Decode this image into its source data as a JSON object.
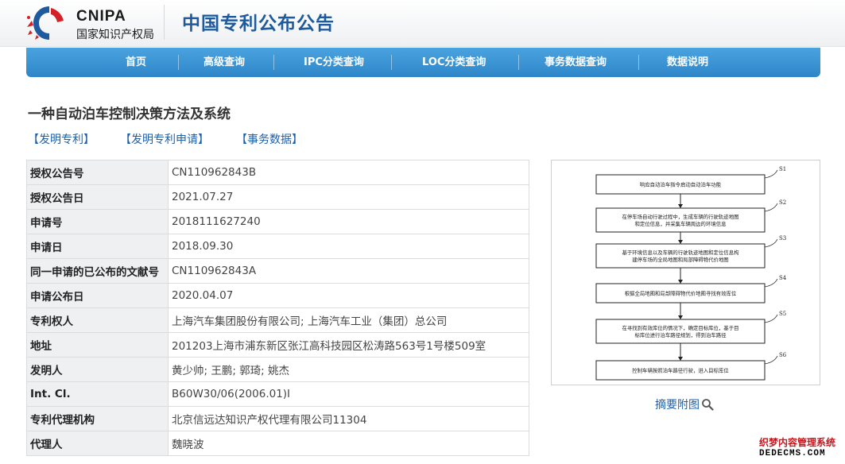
{
  "header": {
    "logo_en": "CNIPA",
    "logo_cn": "国家知识产权局",
    "site_title": "中国专利公布公告"
  },
  "nav": {
    "items": [
      "首页",
      "高级查询",
      "IPC分类查询",
      "LOC分类查询",
      "事务数据查询",
      "数据说明"
    ]
  },
  "document": {
    "title": "一种自动泊车控制决策方法及系统",
    "links": [
      "【发明专利】",
      "【发明专利申请】",
      "【事务数据】"
    ]
  },
  "info_rows": [
    {
      "label": "授权公告号",
      "value": "CN110962843B"
    },
    {
      "label": "授权公告日",
      "value": "2021.07.27"
    },
    {
      "label": "申请号",
      "value": "2018111627240"
    },
    {
      "label": "申请日",
      "value": "2018.09.30"
    },
    {
      "label": "同一申请的已公布的文献号",
      "value": "CN110962843A"
    },
    {
      "label": "申请公布日",
      "value": "2020.04.07"
    },
    {
      "label": "专利权人",
      "value": "上海汽车集团股份有限公司; 上海汽车工业（集团）总公司"
    },
    {
      "label": "地址",
      "value": "201203上海市浦东新区张江高科技园区松涛路563号1号楼509室"
    },
    {
      "label": "发明人",
      "value": "黄少帅; 王鹏; 郭琦; 姚杰"
    },
    {
      "label": "Int. Cl.",
      "value": "B60W30/06(2006.01)I"
    },
    {
      "label": "专利代理机构",
      "value": "北京信远达知识产权代理有限公司11304"
    },
    {
      "label": "代理人",
      "value": "魏晓波"
    }
  ],
  "drawing": {
    "steps": [
      {
        "id": "S1",
        "lines": [
          "响应自动泊车指令启动自动泊车功能"
        ]
      },
      {
        "id": "S2",
        "lines": [
          "在停车场自动行驶过程中，生成车辆的行驶轨迹地图",
          "和定位信息，并采集车辆周边的环境信息"
        ]
      },
      {
        "id": "S3",
        "lines": [
          "基于环境信息以及车辆的行驶轨迹地图和定位信息构",
          "建停车场的全局地图和局部障碍物代价地图"
        ]
      },
      {
        "id": "S4",
        "lines": [
          "根据全局地图和局部障碍物代价地图寻找有效库位"
        ]
      },
      {
        "id": "S5",
        "lines": [
          "在寻找到有效库位的情况下，确定目标库位，基于目",
          "标库位进行泊车路径规划，得到泊车路径"
        ]
      },
      {
        "id": "S6",
        "lines": [
          "控制车辆按照泊车路径行驶，进入目标库位"
        ]
      }
    ],
    "link_label": "摘要附图"
  },
  "watermark": {
    "line1": "织梦内容管理系统",
    "line2": "DEDECMS.COM"
  },
  "colors": {
    "brand_blue": "#1f5a9e",
    "nav_blue": "#3a95d5",
    "link_blue": "#1e5fa8",
    "label_bg": "#eef0f1"
  }
}
